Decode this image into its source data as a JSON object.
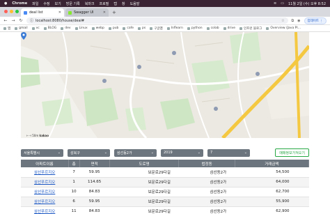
{
  "menubar": {
    "app": "Chrome",
    "items": [
      "파일",
      "수정",
      "보기",
      "방문 기록",
      "북마크",
      "프로필",
      "탭",
      "창",
      "도움말"
    ],
    "clock": "11월 2일 (수) 오후 8:52"
  },
  "tabs": [
    {
      "title": "deal list",
      "active": true
    },
    {
      "title": "Swagger UI",
      "active": false
    }
  ],
  "address": {
    "url": "localhost:8080/house/deal#"
  },
  "toolbar": {
    "update_label": "업데이트 ⋮"
  },
  "bookmarks": [
    "앱",
    "gmail",
    "vc",
    "BLOG",
    "dev",
    "Linux",
    "webp",
    "pub",
    "cafe",
    "ps",
    "구글맵",
    "Inflearn",
    "python",
    "colab",
    "drive",
    "인프런 블로그",
    "Overview (Java Pl…"
  ],
  "map": {
    "scale_label": "50m",
    "logo": "kakao"
  },
  "filters": {
    "sido": "서울특별시",
    "gugun": "성북구",
    "dong": "삼선동2가",
    "year": "2019",
    "month": "7",
    "open_button": "매매정보가져오기"
  },
  "table": {
    "headers": [
      "아파트이름",
      "층",
      "면적",
      "도로명",
      "법정동",
      "거래금액"
    ],
    "rows": [
      {
        "name": "삼선푸르지오",
        "floor": "7",
        "area": "59.95",
        "road": "보문로29다길",
        "dong": "삼선동2가",
        "price": "54,500"
      },
      {
        "name": "삼선푸르지오",
        "floor": "1",
        "area": "114.65",
        "road": "보문로29다길",
        "dong": "삼선동2가",
        "price": "64,000"
      },
      {
        "name": "삼선푸르지오",
        "floor": "10",
        "area": "84.83",
        "road": "보문로29다길",
        "dong": "삼선동2가",
        "price": "62,700"
      },
      {
        "name": "삼선푸르지오",
        "floor": "6",
        "area": "59.95",
        "road": "보문로29다길",
        "dong": "삼선동2가",
        "price": "55,900"
      },
      {
        "name": "삼선푸르지오",
        "floor": "11",
        "area": "84.83",
        "road": "보문로29다길",
        "dong": "삼선동2가",
        "price": "62,900"
      }
    ]
  }
}
